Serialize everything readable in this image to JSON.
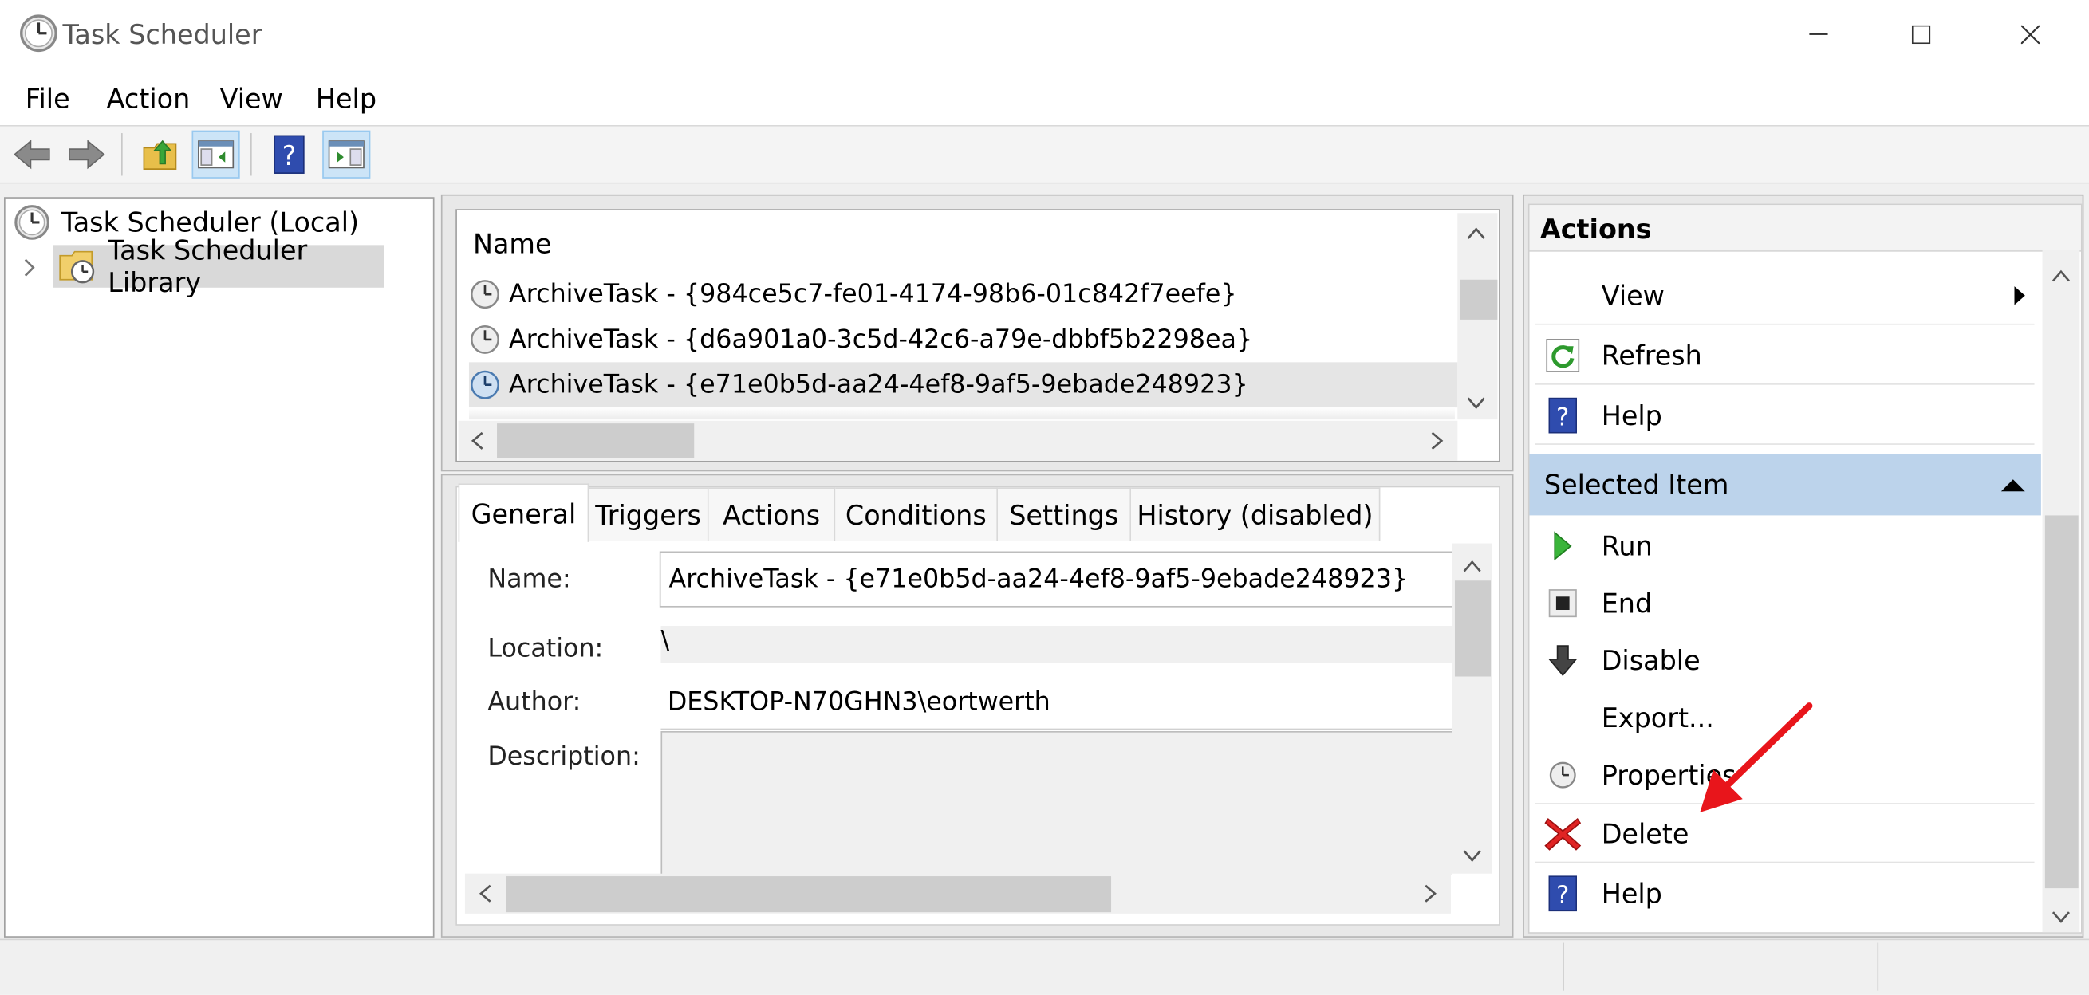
{
  "window": {
    "title": "Task Scheduler"
  },
  "menu": [
    "File",
    "Action",
    "View",
    "Help"
  ],
  "toolbar": [
    "back-icon",
    "forward-icon",
    "up-folder-icon",
    "show-hide-console-tree-icon",
    "help-icon",
    "show-hide-action-pane-icon"
  ],
  "tree": {
    "root": "Task Scheduler (Local)",
    "library": "Task Scheduler Library"
  },
  "tasklist": {
    "header": "Name",
    "rows": [
      "ArchiveTask - {984ce5c7-fe01-4174-98b6-01c842f7eefe}",
      "ArchiveTask - {d6a901a0-3c5d-42c6-a79e-dbbf5b2298ea}",
      "ArchiveTask - {e71e0b5d-aa24-4ef8-9af5-9ebade248923}"
    ]
  },
  "tabs": [
    "General",
    "Triggers",
    "Actions",
    "Conditions",
    "Settings",
    "History (disabled)"
  ],
  "general": {
    "name_label": "Name:",
    "name_value": "ArchiveTask - {e71e0b5d-aa24-4ef8-9af5-9ebade248923}",
    "location_label": "Location:",
    "location_value": "\\",
    "author_label": "Author:",
    "author_value": "DESKTOP-N70GHN3\\eortwerth",
    "description_label": "Description:"
  },
  "actions_pane": {
    "title": "Actions",
    "top_items": [
      "View",
      "Refresh",
      "Help"
    ],
    "selected_header": "Selected Item",
    "selected_items": [
      "Run",
      "End",
      "Disable",
      "Export...",
      "Properties",
      "Delete",
      "Help"
    ]
  },
  "colors": {
    "accent": "#cce4f7",
    "selected_header": "#bcd3eb",
    "arrow": "#e8151b"
  }
}
